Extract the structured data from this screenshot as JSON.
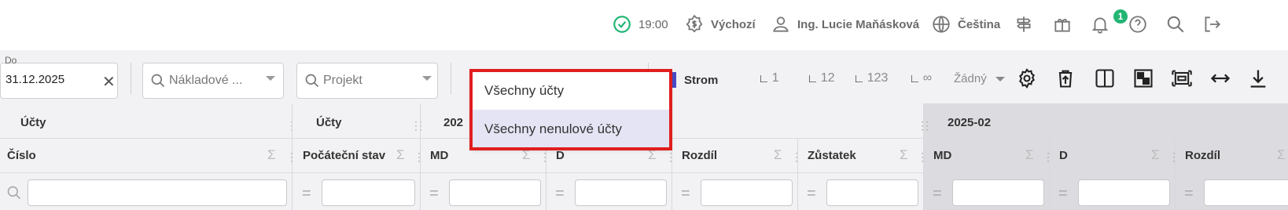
{
  "topbar": {
    "status_time": "19:00",
    "profile": "Výchozí",
    "user": "Ing. Lucie Maňásková",
    "language": "Čeština",
    "gift_badge": "1"
  },
  "filters": {
    "date_label": "Do",
    "date_value": "31.12.2025",
    "cost_center_placeholder": "Nákladové ...",
    "project_placeholder": "Projekt"
  },
  "view": {
    "tree_label": "Strom",
    "levels": [
      "1",
      "12",
      "123",
      "∞"
    ],
    "none_option": "Žádný"
  },
  "dropdown": {
    "options": [
      {
        "label": "Všechny účty",
        "selected": false
      },
      {
        "label": "Všechny nenulové účty",
        "selected": true
      }
    ]
  },
  "grid": {
    "groups": [
      "Účty",
      "Účty",
      "202",
      "2025-02"
    ],
    "columns": [
      "Číslo",
      "Počáteční stav",
      "MD",
      "D",
      "Rozdíl",
      "Zůstatek",
      "MD",
      "D",
      "Rozdíl"
    ]
  },
  "colors": {
    "accent": "#22b573",
    "highlight": "#e01e1e",
    "selected_row": "#e4e4f4"
  }
}
